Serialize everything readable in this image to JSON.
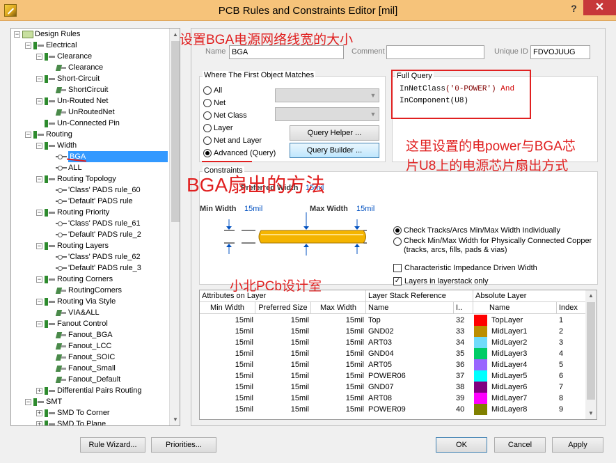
{
  "window": {
    "title": "PCB Rules and Constraints Editor [mil]",
    "help": "?",
    "close": "✕"
  },
  "tree": {
    "rows": [
      {
        "label": "Design Rules",
        "expander": "−",
        "icon": "rules"
      },
      {
        "label": "Electrical",
        "expander": "−",
        "icon": "category"
      },
      {
        "label": "Clearance",
        "expander": "−",
        "icon": "category"
      },
      {
        "label": "Clearance",
        "expander": "",
        "icon": "rule"
      },
      {
        "label": "Short-Circuit",
        "expander": "−",
        "icon": "category"
      },
      {
        "label": "ShortCircuit",
        "expander": "",
        "icon": "rule"
      },
      {
        "label": "Un-Routed Net",
        "expander": "−",
        "icon": "category"
      },
      {
        "label": "UnRoutedNet",
        "expander": "",
        "icon": "rule"
      },
      {
        "label": "Un-Connected Pin",
        "expander": "",
        "icon": "category"
      },
      {
        "label": "Routing",
        "expander": "−",
        "icon": "category"
      },
      {
        "label": "Width",
        "expander": "−",
        "icon": "category"
      },
      {
        "label": "BGA",
        "expander": "",
        "icon": "net",
        "selected": true
      },
      {
        "label": "ALL",
        "expander": "",
        "icon": "net"
      },
      {
        "label": "Routing Topology",
        "expander": "−",
        "icon": "category"
      },
      {
        "label": "'Class' PADS rule_60",
        "expander": "",
        "icon": "net"
      },
      {
        "label": "'Default' PADS rule",
        "expander": "",
        "icon": "net"
      },
      {
        "label": "Routing Priority",
        "expander": "−",
        "icon": "category"
      },
      {
        "label": "'Class' PADS rule_61",
        "expander": "",
        "icon": "net"
      },
      {
        "label": "'Default' PADS rule_2",
        "expander": "",
        "icon": "net"
      },
      {
        "label": "Routing Layers",
        "expander": "−",
        "icon": "category"
      },
      {
        "label": "'Class' PADS rule_62",
        "expander": "",
        "icon": "net"
      },
      {
        "label": "'Default' PADS rule_3",
        "expander": "",
        "icon": "net"
      },
      {
        "label": "Routing Corners",
        "expander": "−",
        "icon": "category"
      },
      {
        "label": "RoutingCorners",
        "expander": "",
        "icon": "rule"
      },
      {
        "label": "Routing Via Style",
        "expander": "−",
        "icon": "category"
      },
      {
        "label": "VIA&ALL",
        "expander": "",
        "icon": "rule"
      },
      {
        "label": "Fanout Control",
        "expander": "−",
        "icon": "category"
      },
      {
        "label": "Fanout_BGA",
        "expander": "",
        "icon": "rule"
      },
      {
        "label": "Fanout_LCC",
        "expander": "",
        "icon": "rule"
      },
      {
        "label": "Fanout_SOIC",
        "expander": "",
        "icon": "rule"
      },
      {
        "label": "Fanout_Small",
        "expander": "",
        "icon": "rule"
      },
      {
        "label": "Fanout_Default",
        "expander": "",
        "icon": "rule"
      },
      {
        "label": "Differential Pairs Routing",
        "expander": "+",
        "icon": "category"
      },
      {
        "label": "SMT",
        "expander": "−",
        "icon": "category"
      },
      {
        "label": "SMD To Corner",
        "expander": "+",
        "icon": "category"
      },
      {
        "label": "SMD To Plane",
        "expander": "+",
        "icon": "category"
      }
    ]
  },
  "rule": {
    "name_label": "Name",
    "name": "BGA",
    "comment_label": "Comment",
    "comment": "",
    "uid_label": "Unique ID",
    "uid": "FDVOJUUG"
  },
  "match": {
    "title": "Where The First Object Matches",
    "options": [
      "All",
      "Net",
      "Net Class",
      "Layer",
      "Net and Layer",
      "Advanced (Query)"
    ],
    "selected_index": 5,
    "query_helper": "Query Helper ...",
    "query_builder": "Query Builder ..."
  },
  "full_query": {
    "title": "Full Query",
    "line1_fn": "InNetClass",
    "line1_arg": "('0-POWER')",
    "line1_op": "And",
    "line2": "InComponent(U8)"
  },
  "constraints": {
    "title": "Constraints",
    "preferred_label": "Preferred Width",
    "preferred_value": "15mil",
    "min_label": "Min Width",
    "min_value": "15mil",
    "max_label": "Max Width",
    "max_value": "15mil",
    "opt_individually": "Check Tracks/Arcs Min/Max Width Individually",
    "opt_physical_1": "Check Min/Max Width for Physically Connected Copper",
    "opt_physical_2": "(tracks, arcs, fills, pads & vias)",
    "impedance": "Characteristic Impedance Driven Width",
    "layerstack_only": "Layers in layerstack only",
    "check_mark": "✓"
  },
  "layer_table": {
    "group_attrs": "Attributes on Layer",
    "group_stack": "Layer Stack Reference",
    "group_abs": "Absolute Layer",
    "col_min": "Min Width",
    "col_pref": "Preferred Size",
    "col_max": "Max Width",
    "col_name": "Name",
    "col_idx": "I..",
    "col_abs_name": "Name",
    "col_index": "Index",
    "rows": [
      {
        "min": "15mil",
        "pref": "15mil",
        "max": "15mil",
        "stack": "Top",
        "i": "32",
        "abs": "TopLayer",
        "color": "#ff0000",
        "index": "1"
      },
      {
        "min": "15mil",
        "pref": "15mil",
        "max": "15mil",
        "stack": "GND02",
        "i": "33",
        "abs": "MidLayer1",
        "color": "#bc8e00",
        "index": "2"
      },
      {
        "min": "15mil",
        "pref": "15mil",
        "max": "15mil",
        "stack": "ART03",
        "i": "34",
        "abs": "MidLayer2",
        "color": "#70dbfa",
        "index": "3"
      },
      {
        "min": "15mil",
        "pref": "15mil",
        "max": "15mil",
        "stack": "GND04",
        "i": "35",
        "abs": "MidLayer3",
        "color": "#00cc66",
        "index": "4"
      },
      {
        "min": "15mil",
        "pref": "15mil",
        "max": "15mil",
        "stack": "ART05",
        "i": "36",
        "abs": "MidLayer4",
        "color": "#9966ff",
        "index": "5"
      },
      {
        "min": "15mil",
        "pref": "15mil",
        "max": "15mil",
        "stack": "POWER06",
        "i": "37",
        "abs": "MidLayer5",
        "color": "#00ffff",
        "index": "6"
      },
      {
        "min": "15mil",
        "pref": "15mil",
        "max": "15mil",
        "stack": "GND07",
        "i": "38",
        "abs": "MidLayer6",
        "color": "#800080",
        "index": "7"
      },
      {
        "min": "15mil",
        "pref": "15mil",
        "max": "15mil",
        "stack": "ART08",
        "i": "39",
        "abs": "MidLayer7",
        "color": "#ff00ff",
        "index": "8"
      },
      {
        "min": "15mil",
        "pref": "15mil",
        "max": "15mil",
        "stack": "POWER09",
        "i": "40",
        "abs": "MidLayer8",
        "color": "#808000",
        "index": "9"
      }
    ]
  },
  "buttons": {
    "rule_wizard": "Rule Wizard...",
    "priorities": "Priorities...",
    "ok": "OK",
    "cancel": "Cancel",
    "apply": "Apply"
  },
  "annotations": {
    "title": "设置BGA电源网络线宽的大小",
    "query_note_1": "这里设置的电power与BGA芯",
    "query_note_2": "片U8上的电源芯片扇出方式",
    "fanout": "BGA扇出的方法",
    "credit": "小北PCb设计室"
  },
  "colors": {
    "annotation": "#e02020",
    "selection": "#3399ff",
    "titlebar": "#f6c37a",
    "track": "#f4b400"
  }
}
